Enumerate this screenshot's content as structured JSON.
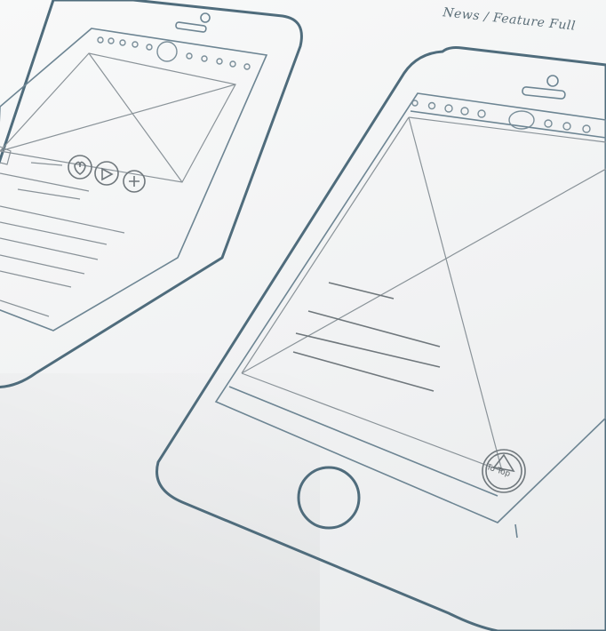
{
  "sketch_label": "News / Feature Full",
  "back_to_top_label": "To Top",
  "colors": {
    "paper": "#f2f3f4",
    "device_outline": "#4f6c7c",
    "pencil": "#8a9399"
  },
  "icons": {
    "left_phone_actions": [
      "heart-icon",
      "play-icon",
      "plus-icon"
    ],
    "right_phone_scroll": "up-arrow-icon"
  }
}
